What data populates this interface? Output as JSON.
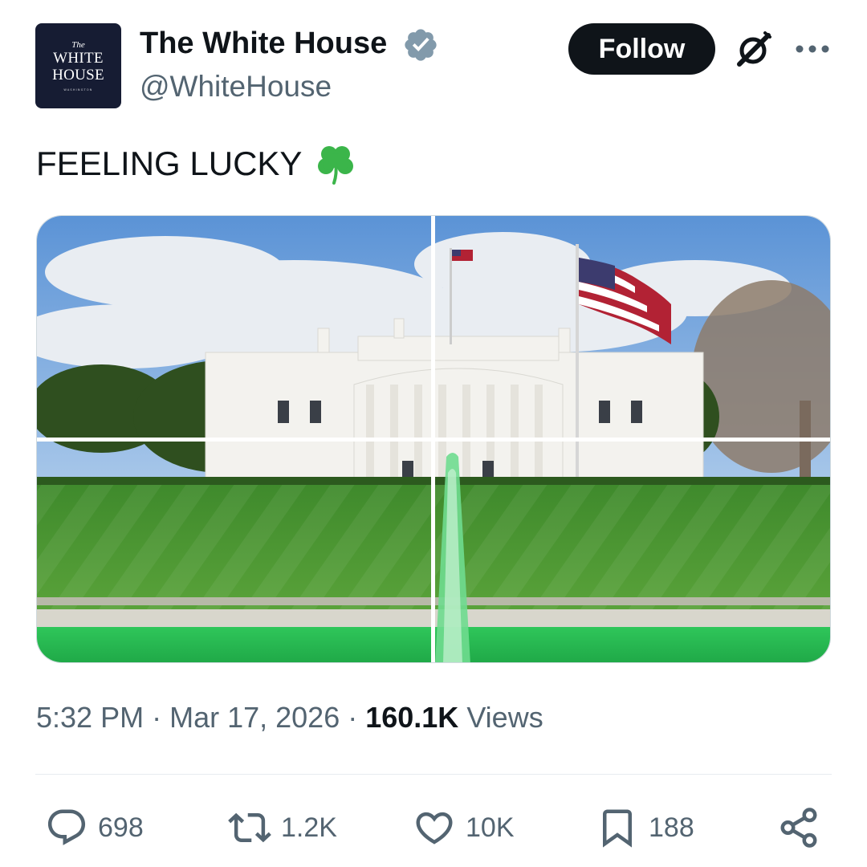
{
  "author": {
    "display_name": "The White House",
    "handle": "@WhiteHouse",
    "verified_badge_icon": "verified-badge-icon",
    "verified_color": "#829aab",
    "avatar": {
      "line1": "The",
      "line2": "WHITE",
      "line3": "HOUSE",
      "line4": "WASHINGTON"
    }
  },
  "header_actions": {
    "follow_label": "Follow",
    "grok_icon": "grok-icon",
    "more_icon": "more-horizontal-icon"
  },
  "tweet": {
    "text": "FEELING LUCKY",
    "emoji_icon": "four-leaf-clover-icon",
    "media": {
      "type": "photo-grid-2x2",
      "description_icon": "photo"
    }
  },
  "meta": {
    "time": "5:32 PM",
    "separator": " · ",
    "date": "Mar 17, 2026",
    "views_count": "160.1K",
    "views_label": " Views"
  },
  "actions": {
    "reply": {
      "icon": "reply-icon",
      "count": "698"
    },
    "repost": {
      "icon": "repost-icon",
      "count": "1.2K"
    },
    "like": {
      "icon": "heart-icon",
      "count": "10K"
    },
    "bookmark": {
      "icon": "bookmark-icon",
      "count": "188"
    },
    "share": {
      "icon": "share-icon"
    }
  },
  "colors": {
    "text_primary": "#0f1419",
    "text_secondary": "#536471",
    "follow_bg": "#0f1419",
    "fountain_green": "#2ecb5a"
  }
}
